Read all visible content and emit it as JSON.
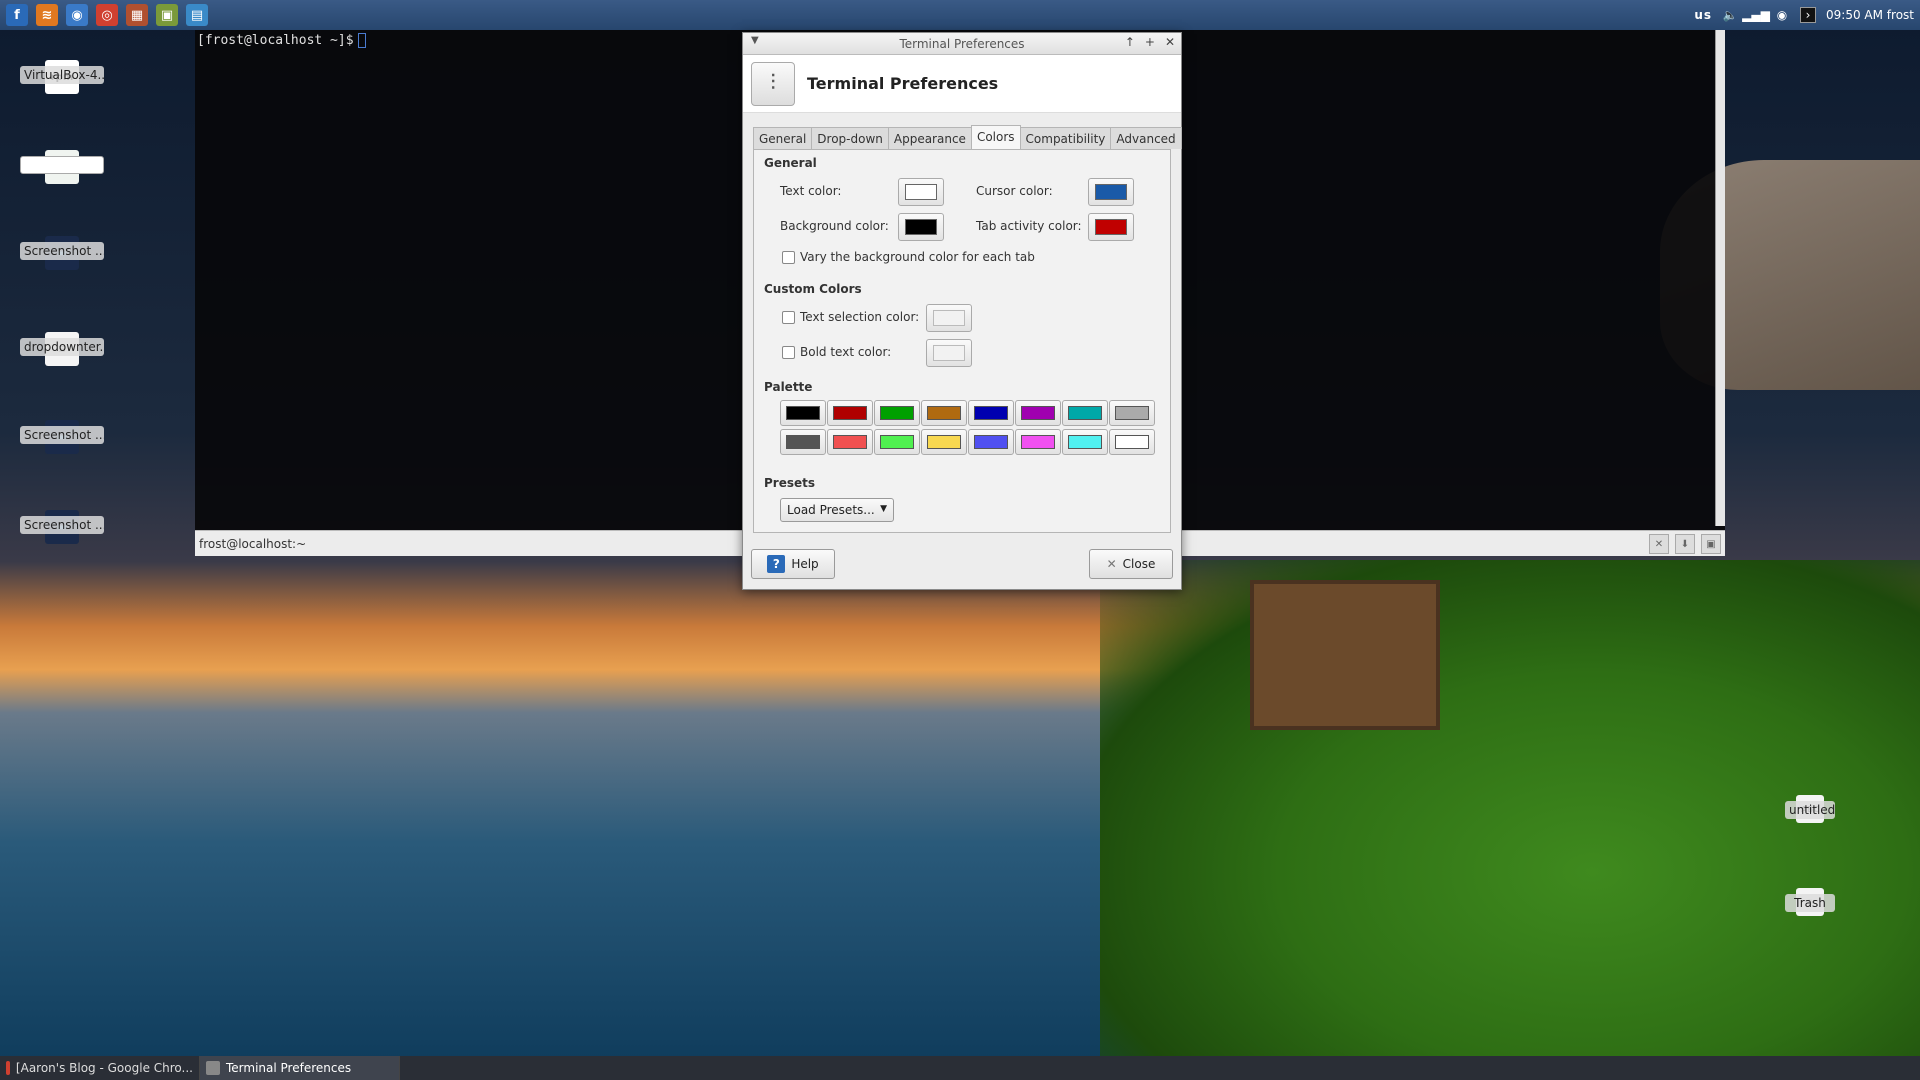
{
  "top_panel": {
    "launchers": [
      {
        "name": "fedora-menu-icon",
        "glyph": "f",
        "color": "#2a6ab8"
      },
      {
        "name": "rss-icon",
        "glyph": "≋",
        "color": "#e07820"
      },
      {
        "name": "web-browser-icon",
        "glyph": "◉",
        "color": "#3a7ac8"
      },
      {
        "name": "chrome-icon",
        "glyph": "◎",
        "color": "#d04030"
      },
      {
        "name": "firewall-icon",
        "glyph": "▦",
        "color": "#b05030"
      },
      {
        "name": "notes-icon",
        "glyph": "▣",
        "color": "#7a9a3a"
      },
      {
        "name": "monitor-icon",
        "glyph": "▤",
        "color": "#3a8ac8"
      }
    ],
    "tray": {
      "keyboard": "us",
      "clock": "09:50 AM",
      "user": "frost"
    }
  },
  "desktop_icons": [
    {
      "label": "VirtualBox-4...",
      "glyph": "rpm",
      "bg": "#ffffff",
      "fg": "#000000"
    },
    {
      "label": "",
      "glyph": "C",
      "bg": "#f0f4f0",
      "fg": "#3a9a4a"
    },
    {
      "label": "Screenshot ...",
      "glyph": "▬",
      "bg": "#1a2a4a",
      "fg": "#5a9ad0"
    },
    {
      "label": "dropdownter...",
      "glyph": "≡",
      "bg": "#f5f5f5",
      "fg": "#888888"
    },
    {
      "label": "Screenshot ...",
      "glyph": "▬",
      "bg": "#1a2a4a",
      "fg": "#5a9ad0"
    },
    {
      "label": "Screenshot ...",
      "glyph": "▬",
      "bg": "#1a2a4a",
      "fg": "#5a9ad0"
    }
  ],
  "right_icons": [
    {
      "label": "untitled",
      "glyph": "ABC"
    },
    {
      "label": "Trash",
      "glyph": "♲"
    }
  ],
  "terminal": {
    "prompt": "[frost@localhost ~]$",
    "status": "frost@localhost:~"
  },
  "dialog": {
    "window_title": "Terminal Preferences",
    "header_title": "Terminal Preferences",
    "tabs": [
      "General",
      "Drop-down",
      "Appearance",
      "Colors",
      "Compatibility",
      "Advanced"
    ],
    "active_tab": "Colors",
    "general": {
      "section": "General",
      "text_color_label": "Text color:",
      "cursor_color_label": "Cursor color:",
      "background_color_label": "Background color:",
      "tab_activity_color_label": "Tab activity color:",
      "vary_label": "Vary the background color for each tab",
      "text_color": "#ffffff",
      "cursor_color": "#1a5aa8",
      "background_color": "#000000",
      "tab_activity_color": "#c00000"
    },
    "custom": {
      "section": "Custom Colors",
      "text_selection_label": "Text selection color:",
      "bold_text_label": "Bold text color:",
      "text_selection_color": "#f2f2f2",
      "bold_text_color": "#f2f2f2"
    },
    "palette": {
      "section": "Palette",
      "colors": [
        "#000000",
        "#b00000",
        "#00a000",
        "#b06a10",
        "#0000b0",
        "#a000b0",
        "#00a8a8",
        "#aaaaaa",
        "#555555",
        "#f05050",
        "#50f050",
        "#f8d850",
        "#5050f0",
        "#f050f0",
        "#50f0f0",
        "#ffffff"
      ]
    },
    "presets": {
      "section": "Presets",
      "selected": "Load Presets..."
    },
    "help_label": "Help",
    "close_label": "Close"
  },
  "taskbar": [
    {
      "label": "[Aaron's Blog - Google Chro...",
      "active": false
    },
    {
      "label": "Terminal Preferences",
      "active": true
    }
  ]
}
